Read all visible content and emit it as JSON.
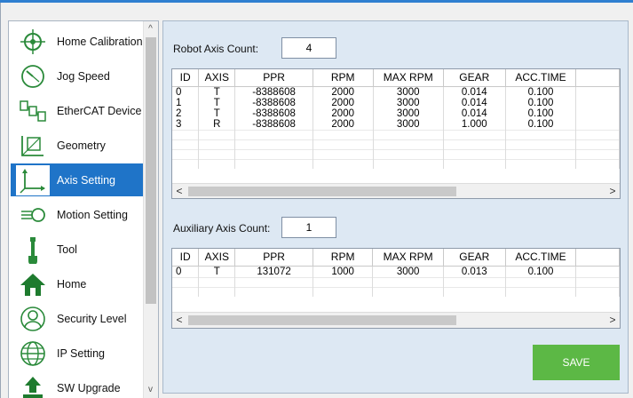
{
  "sidebar": {
    "items": [
      {
        "label": "Home Calibration",
        "icon": "crosshair-icon"
      },
      {
        "label": "Jog Speed",
        "icon": "speedometer-icon"
      },
      {
        "label": "EtherCAT Device",
        "icon": "ethercat-chain-icon"
      },
      {
        "label": "Geometry",
        "icon": "geometry-icon"
      },
      {
        "label": "Axis Setting",
        "icon": "axis-icon",
        "active": true
      },
      {
        "label": "Motion Setting",
        "icon": "motion-icon"
      },
      {
        "label": "Tool",
        "icon": "tool-icon"
      },
      {
        "label": "Home",
        "icon": "house-icon"
      },
      {
        "label": "Security Level",
        "icon": "user-icon"
      },
      {
        "label": "IP Setting",
        "icon": "globe-icon"
      },
      {
        "label": "SW Upgrade",
        "icon": "upload-icon"
      }
    ],
    "scroll_up": "^",
    "scroll_down": "v"
  },
  "robot": {
    "count_label": "Robot Axis Count:",
    "count_value": "4",
    "columns": [
      "ID",
      "AXIS",
      "PPR",
      "RPM",
      "MAX RPM",
      "GEAR",
      "ACC.TIME"
    ],
    "rows": [
      [
        "0",
        "T",
        "-8388608",
        "2000",
        "3000",
        "0.014",
        "0.100"
      ],
      [
        "1",
        "T",
        "-8388608",
        "2000",
        "3000",
        "0.014",
        "0.100"
      ],
      [
        "2",
        "T",
        "-8388608",
        "2000",
        "3000",
        "0.014",
        "0.100"
      ],
      [
        "3",
        "R",
        "-8388608",
        "2000",
        "3000",
        "1.000",
        "0.100"
      ]
    ]
  },
  "auxiliary": {
    "count_label": "Auxiliary Axis Count:",
    "count_value": "1",
    "columns": [
      "ID",
      "AXIS",
      "PPR",
      "RPM",
      "MAX RPM",
      "GEAR",
      "ACC.TIME"
    ],
    "rows": [
      [
        "0",
        "T",
        "131072",
        "1000",
        "3000",
        "0.013",
        "0.100"
      ]
    ]
  },
  "scroll_left": "<",
  "scroll_right": ">",
  "save_label": "SAVE",
  "colors": {
    "accent": "#1f74c8",
    "save": "#5cb845",
    "icon": "#2a8a3a"
  }
}
